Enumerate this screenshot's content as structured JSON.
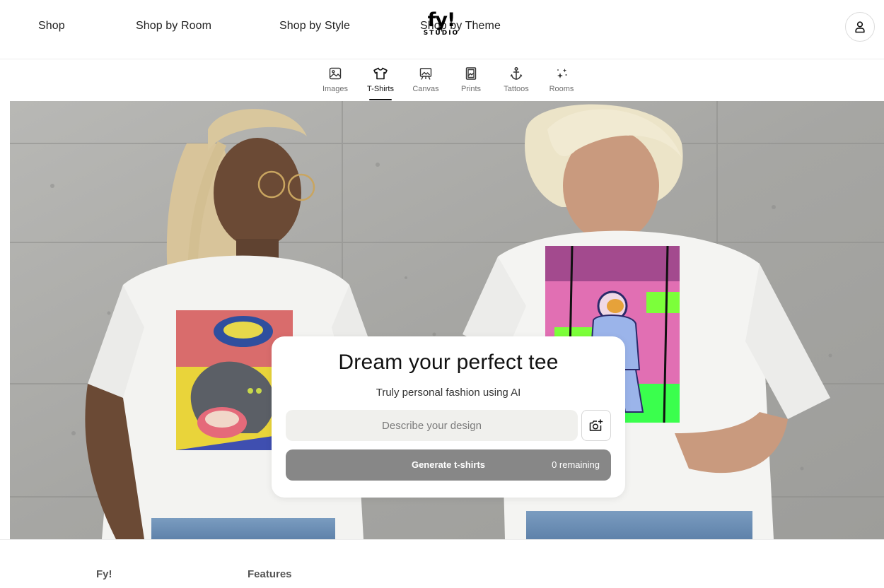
{
  "header": {
    "nav": [
      "Shop",
      "Shop by Room",
      "Shop by Style",
      "Shop by Theme"
    ],
    "logo": {
      "main": "fy!",
      "sub": "STUDIO"
    }
  },
  "tabs": [
    {
      "label": "Images",
      "icon": "image-icon"
    },
    {
      "label": "T-Shirts",
      "icon": "tshirt-icon",
      "active": true
    },
    {
      "label": "Canvas",
      "icon": "canvas-easel-icon"
    },
    {
      "label": "Prints",
      "icon": "print-frame-icon"
    },
    {
      "label": "Tattoos",
      "icon": "anchor-icon"
    },
    {
      "label": "Rooms",
      "icon": "sparkles-icon"
    }
  ],
  "hero": {
    "card": {
      "title": "Dream your perfect tee",
      "subtitle": "Truly personal fashion using AI",
      "input_placeholder": "Describe your design",
      "generate_label": "Generate t-shirts",
      "remaining": "0 remaining"
    }
  },
  "footer": {
    "columns": [
      "Fy!",
      "Features"
    ]
  },
  "colors": {
    "generate_button": "#878787",
    "input_background": "#f0f0ed",
    "concrete_wall": "#a9a9a6"
  }
}
